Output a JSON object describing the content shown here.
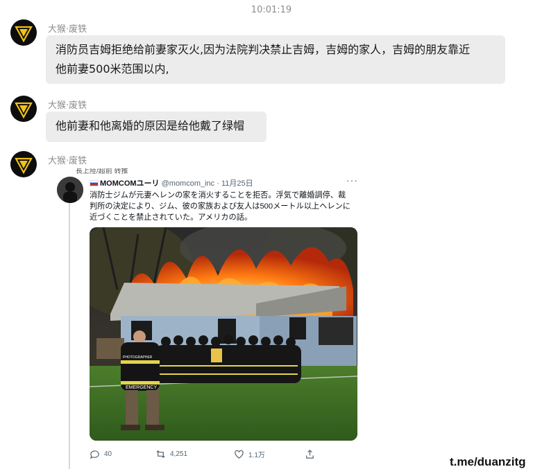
{
  "chat": {
    "timestamp": "10:01:19",
    "messages": [
      {
        "sender": "大猴·废铁",
        "text_lines": [
          "消防员吉姆拒绝给前妻家灭火,因为法院判决禁止吉姆，吉姆的家人，吉姆的朋友靠近",
          "他前妻500米范围以内,"
        ]
      },
      {
        "sender": "大猴·废铁",
        "text_lines": [
          "他前妻和他离婚的原因是给他戴了绿帽"
        ]
      },
      {
        "sender": "大猴·废铁",
        "type": "image"
      }
    ]
  },
  "tweet": {
    "cut_text": "長上陸/超前 转推",
    "name": "MOMCOMユーリ",
    "handle": "@momcom_inc",
    "date": "· 11月25日",
    "more": "···",
    "text_lines": [
      "消防士ジムが元妻ヘレンの家を消火することを拒否。浮気で離婚調停、裁",
      "判所の決定により、ジム、彼の家族および友人は500メートル以上ヘレンに",
      "近づくことを禁止されていた。アメリカの話。"
    ],
    "photo": {
      "vest_text": "PHOTOGRAPHER",
      "back_text": "EMERGENCY"
    },
    "actions": {
      "replies": "40",
      "retweets": "4,251",
      "likes": "1.1万"
    }
  },
  "watermark": "t.me/duanzitg",
  "colors": {
    "bubble": "#ececec",
    "background": "#ffffff",
    "avatar": "#0d0d0d",
    "avatar_emblem": "#f2c21a"
  }
}
